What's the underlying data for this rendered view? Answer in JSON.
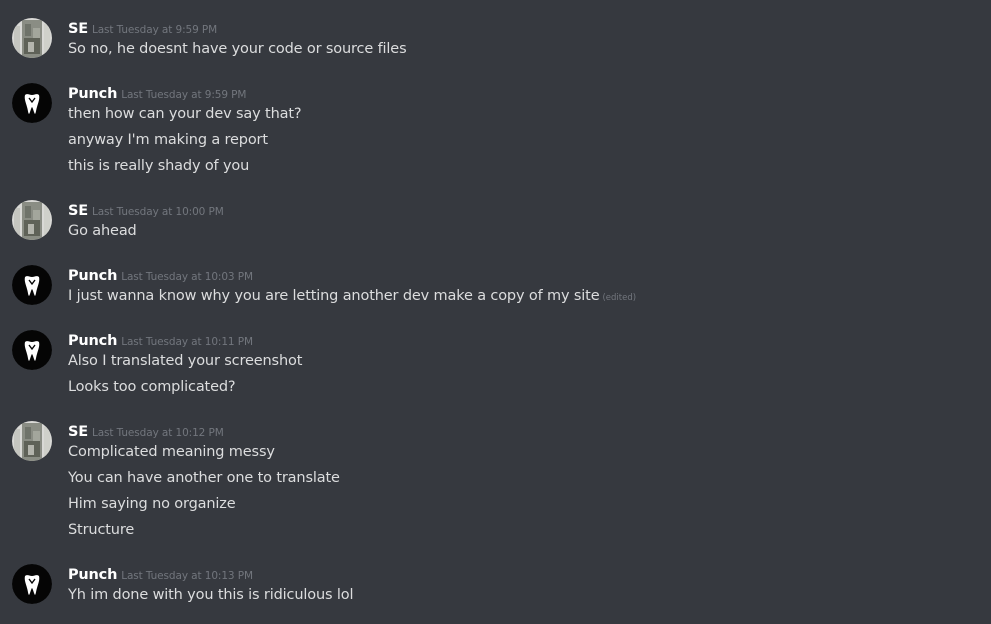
{
  "messages": [
    {
      "author": "SE",
      "timestamp": "Last Tuesday at 9:59 PM",
      "lines": [
        "So no, he doesnt have your code or source files"
      ]
    },
    {
      "author": "Punch",
      "timestamp": "Last Tuesday at 9:59 PM",
      "lines": [
        "then how can your dev say that?",
        "anyway I'm making a report",
        "this is really shady of you"
      ]
    },
    {
      "author": "SE",
      "timestamp": "Last Tuesday at 10:00 PM",
      "lines": [
        "Go ahead"
      ]
    },
    {
      "author": "Punch",
      "timestamp": "Last Tuesday at 10:03 PM",
      "lines": [
        "I just wanna know why you are letting another dev make a copy of my site"
      ],
      "edited_label": "(edited)"
    },
    {
      "author": "Punch",
      "timestamp": "Last Tuesday at 10:11 PM",
      "lines": [
        "Also I translated your screenshot",
        "Looks too complicated?"
      ]
    },
    {
      "author": "SE",
      "timestamp": "Last Tuesday at 10:12 PM",
      "lines": [
        "Complicated meaning messy",
        "You can have another one to translate",
        "Him saying no organize",
        "Structure"
      ]
    },
    {
      "author": "Punch",
      "timestamp": "Last Tuesday at 10:13 PM",
      "lines": [
        "Yh im done with you this is ridiculous lol"
      ]
    }
  ],
  "colors": {
    "background": "#36393f",
    "username": "#ffffff",
    "message_text": "#dcddde",
    "timestamp": "#72767d"
  },
  "icons": {
    "se_avatar": "photo-avatar",
    "punch_avatar": "tooth-logo-avatar"
  }
}
